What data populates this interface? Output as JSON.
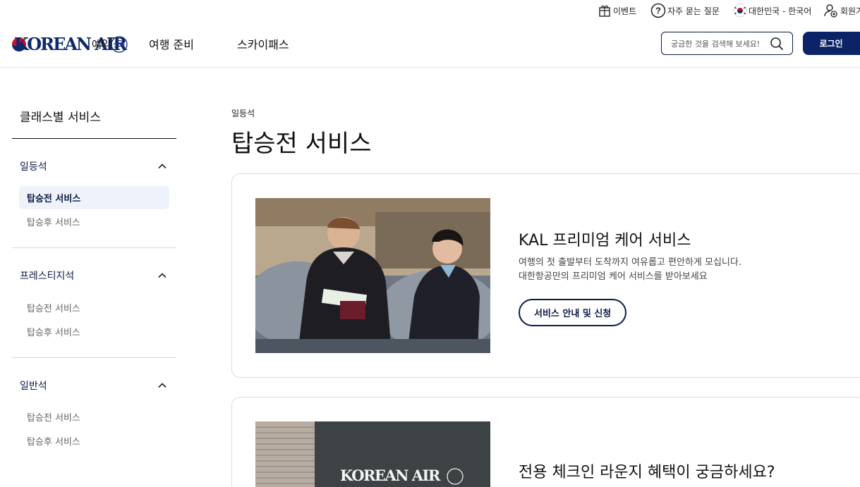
{
  "utility": {
    "events": "이벤트",
    "faq": "자주 묻는 질문",
    "locale": "대한민국 - 한국어",
    "join": "회원가"
  },
  "header": {
    "logo_text": "KOREAN AIR",
    "overlap_text": "예약",
    "nav": [
      "여행 준비",
      "스카이패스"
    ],
    "search_placeholder": "궁금한 것을 검색해 보세요!",
    "login": "로그인"
  },
  "sidebar": {
    "title": "클래스별 서비스",
    "groups": [
      {
        "label": "일등석",
        "items": [
          "탑승전 서비스",
          "탑승후 서비스"
        ],
        "active": 0
      },
      {
        "label": "프레스티지석",
        "items": [
          "탑승전 서비스",
          "탑승후 서비스"
        ]
      },
      {
        "label": "일반석",
        "items": [
          "탑승전 서비스",
          "탑승후 서비스"
        ]
      }
    ]
  },
  "main": {
    "breadcrumb": "일등석",
    "title": "탑승전 서비스",
    "cards": [
      {
        "heading": "KAL 프리미엄 케어 서비스",
        "desc_line1": "여행의 첫 출발부터 도착까지 여유롭고 편안하게 모십니다.",
        "desc_line2": "대한항공만의 프리미엄 케어 서비스를 받아보세요",
        "button": "서비스 안내 및 신청"
      },
      {
        "heading": "전용 체크인 라운지 혜택이 궁금하세요?",
        "image_text": "KOREAN AIR"
      }
    ]
  },
  "colors": {
    "brand_navy": "#0c2467",
    "active_bg": "#eef3fb"
  }
}
